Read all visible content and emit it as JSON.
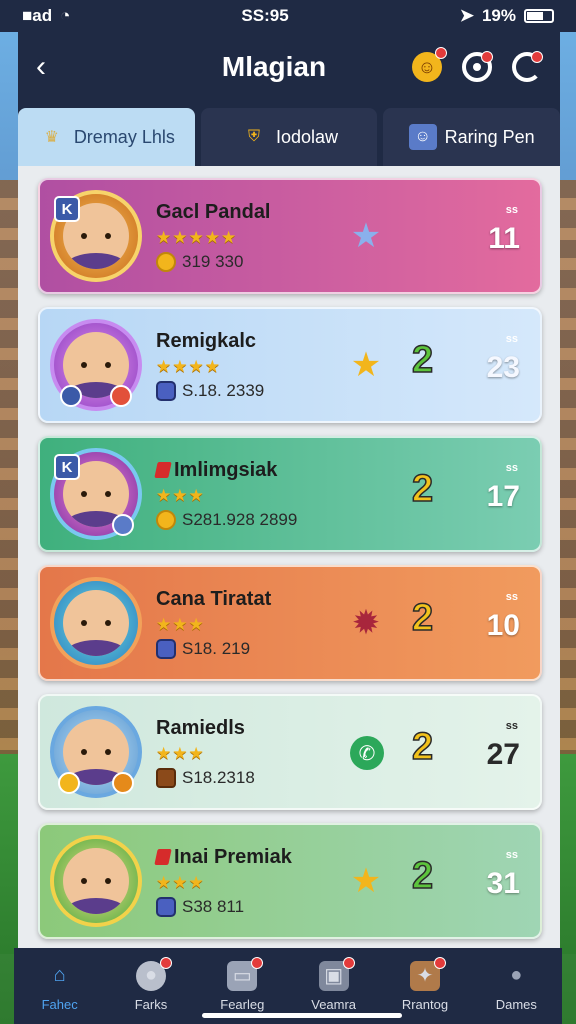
{
  "status": {
    "time": "SS:95",
    "carrier": "■ad",
    "battery": "19%"
  },
  "header": {
    "title": "Mlagian"
  },
  "tabs": [
    {
      "label": "Dremay Lhls",
      "icon": "crown-icon"
    },
    {
      "label": "Iodolaw",
      "icon": "shield-icon"
    },
    {
      "label": "Raring Pen",
      "icon": "player-icon"
    }
  ],
  "players": [
    {
      "name": "Gacl Pandal",
      "stars": "★★★★★",
      "meta": "319 330",
      "score": "11",
      "score_small": "ss",
      "mid_icon": "star-shield-icon",
      "rank_label": "",
      "bg": "linear-gradient(90deg,#b04fa2,#e36b9e)"
    },
    {
      "name": "Remigkalc",
      "stars": "★★★★",
      "meta": "S.18. 2339",
      "score": "23",
      "score_small": "ss",
      "mid_icon": "gold-star-icon",
      "rank_label": "2",
      "bg": "linear-gradient(90deg,#b7d7f5,#d5e8fb)"
    },
    {
      "name": "Imlimgsiak",
      "stars": "★★★",
      "meta": "S281.928 2899",
      "score": "17",
      "score_small": "ss",
      "mid_icon": "",
      "rank_label": "2",
      "bg": "linear-gradient(90deg,#3fb07d,#7bcdb2)"
    },
    {
      "name": "Cana Tiratat",
      "stars": "★★★",
      "meta": "S18. 219",
      "score": "10",
      "score_small": "ss",
      "mid_icon": "gear-icon",
      "rank_label": "2",
      "bg": "linear-gradient(90deg,#e4774a,#f19b5e)"
    },
    {
      "name": "Ramiedls",
      "stars": "★★★",
      "meta": "S18.2318",
      "score": "27",
      "score_small": "ss",
      "mid_icon": "whatsapp-icon",
      "rank_label": "2",
      "bg": "linear-gradient(90deg,#cfe8dd,#e4f3ea)"
    },
    {
      "name": "Inai Premiak",
      "stars": "★★★",
      "meta": "S38 811",
      "score": "31",
      "score_small": "ss",
      "mid_icon": "gold-star-icon",
      "rank_label": "2",
      "bg": "linear-gradient(90deg,#8cc97a,#9fd5b4)"
    }
  ],
  "nav": [
    {
      "label": "Fahec",
      "icon": "home-icon"
    },
    {
      "label": "Farks",
      "icon": "whistle-icon"
    },
    {
      "label": "Fearleg",
      "icon": "trophy-icon"
    },
    {
      "label": "Veamra",
      "icon": "box-icon"
    },
    {
      "label": "Rrantog",
      "icon": "bag-icon"
    },
    {
      "label": "Dames",
      "icon": "user-icon"
    }
  ],
  "colors": {
    "header_bg": "#1f2a44",
    "accent": "#4fa3f0",
    "star": "#f2b51c",
    "notification": "#e33b3b"
  }
}
